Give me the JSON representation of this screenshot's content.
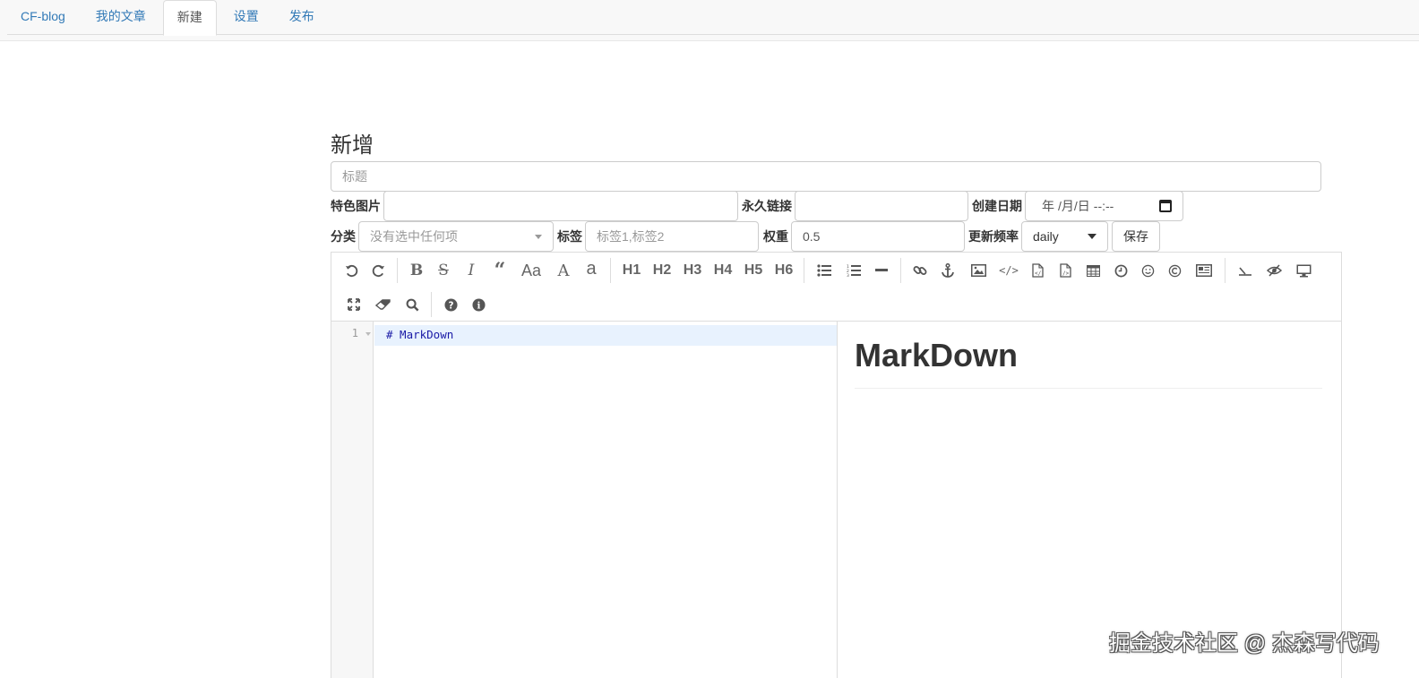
{
  "nav": {
    "tabs": [
      {
        "label": "CF-blog"
      },
      {
        "label": "我的文章"
      },
      {
        "label": "新建"
      },
      {
        "label": "设置"
      },
      {
        "label": "发布"
      }
    ],
    "active_tab": "新建"
  },
  "page": {
    "title": "新增"
  },
  "form": {
    "title_placeholder": "标题",
    "featured_image_label": "特色图片",
    "featured_image_value": "",
    "permalink_label": "永久链接",
    "permalink_value": "",
    "created_date_label": "创建日期",
    "created_date_year": "年",
    "created_date_month_day": "/月/日",
    "created_date_time": "--:--",
    "category_label": "分类",
    "category_placeholder": "没有选中任何项",
    "tags_label": "标签",
    "tags_placeholder": "标签1,标签2",
    "weight_label": "权重",
    "weight_value": "0.5",
    "update_freq_label": "更新频率",
    "update_freq_value": "daily",
    "save_label": "保存"
  },
  "editor": {
    "toolbar_icons": [
      "undo-icon",
      "redo-icon",
      "bold-icon",
      "strikethrough-icon",
      "italic-icon",
      "quote-icon",
      "uppercase-icon",
      "first-uppercase-icon",
      "lowercase-icon",
      "h1-icon",
      "h2-icon",
      "h3-icon",
      "h4-icon",
      "h5-icon",
      "h6-icon",
      "unordered-list-icon",
      "ordered-list-icon",
      "horizontal-rule-icon",
      "link-icon",
      "anchor-icon",
      "image-icon",
      "code-icon",
      "code-block-icon",
      "preformatted-icon",
      "table-icon",
      "datetime-icon",
      "emoji-icon",
      "html-entities-icon",
      "pagebreak-icon",
      "watch-icon",
      "preview-icon",
      "fullscreen-preview-icon",
      "fullscreen-icon",
      "clear-icon",
      "search-icon",
      "help-icon",
      "info-icon"
    ],
    "heading_labels": [
      "H1",
      "H2",
      "H3",
      "H4",
      "H5",
      "H6"
    ],
    "aa_label": "Aa",
    "A_label": "A",
    "a_label": "a",
    "line_number": "1",
    "code_line": "# MarkDown",
    "preview_heading": "MarkDown"
  },
  "watermark": "掘金技术社区 @ 杰森写代码"
}
